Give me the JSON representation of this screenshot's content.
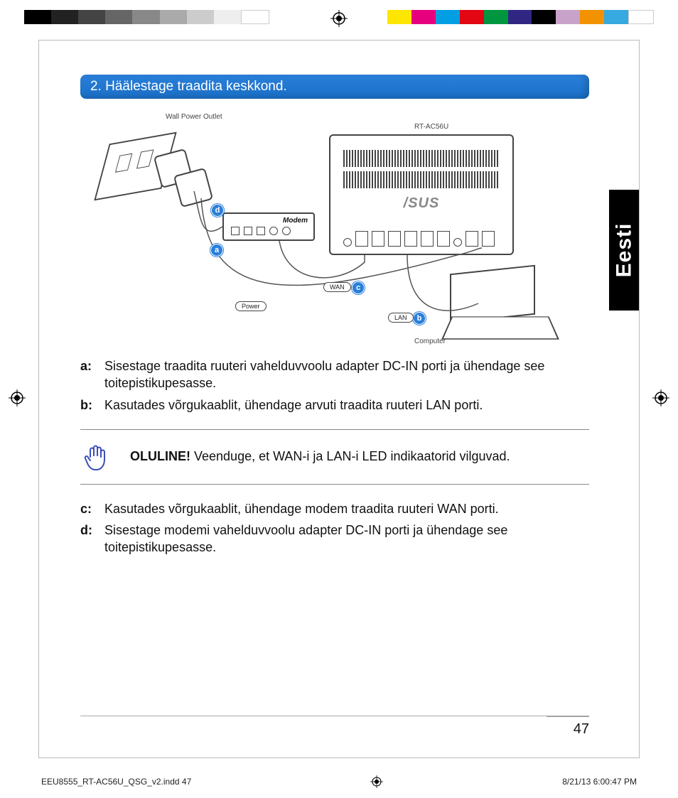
{
  "language_tab": "Eesti",
  "heading": "2.  Häälestage traadita keskkond.",
  "diagram": {
    "wall_outlet_label": "Wall Power Outlet",
    "router_label": "RT-AC56U",
    "modem_label": "Modem",
    "computer_label": "Computer",
    "router_logo": "/SUS",
    "pill_wan": "WAN",
    "pill_lan": "LAN",
    "pill_power": "Power",
    "callouts": {
      "a": "a",
      "b": "b",
      "c": "c",
      "d": "d"
    }
  },
  "steps_top": [
    {
      "key": "a:",
      "text": "Sisestage traadita ruuteri vahelduvvoolu adapter DC-IN porti ja ühendage see toitepistikupesasse."
    },
    {
      "key": "b:",
      "text": "Kasutades võrgukaablit, ühendage arvuti traadita ruuteri LAN porti."
    }
  ],
  "note": {
    "bold": "OLULINE!",
    "text": "  Veenduge, et WAN-i ja LAN-i LED indikaatorid vilguvad."
  },
  "steps_bottom": [
    {
      "key": "c:",
      "text": "Kasutades võrgukaablit, ühendage modem traadita ruuteri WAN porti."
    },
    {
      "key": "d:",
      "text": "Sisestage modemi vahelduvvoolu adapter DC-IN porti ja ühendage see toitepistikupesasse."
    }
  ],
  "page_number": "47",
  "footer": {
    "file": "EEU8555_RT-AC56U_QSG_v2.indd   47",
    "date": "8/21/13   6:00:47 PM"
  }
}
